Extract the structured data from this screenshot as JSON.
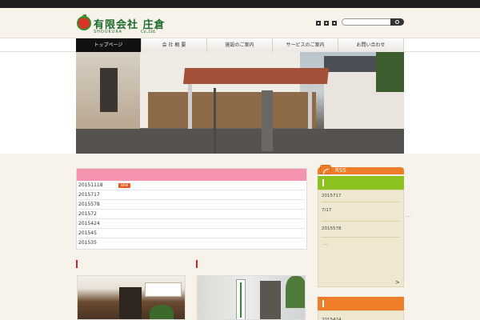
{
  "header": {
    "logo_title": "有限会社 庄倉",
    "logo_sub": "SHOUKURA",
    "logo_co": "Co.,Ltd.",
    "social_icons": [
      "twitter-icon",
      "facebook-icon",
      "rss-small-icon"
    ],
    "search_placeholder": ""
  },
  "nav": {
    "items": [
      {
        "label": "トップページ",
        "active": true
      },
      {
        "label": "会 社 概 要"
      },
      {
        "label": "施設のご案内"
      },
      {
        "label": "サービスのご案内"
      },
      {
        "label": "お問い合わせ"
      }
    ]
  },
  "news": {
    "items": [
      {
        "date": "20151118",
        "badge": "NEW"
      },
      {
        "date": "2015717"
      },
      {
        "date": "2015578"
      },
      {
        "date": "201572"
      },
      {
        "date": "2015424"
      },
      {
        "date": "201545"
      },
      {
        "date": "201535"
      }
    ]
  },
  "sidebar": {
    "rss_label": "RSS",
    "panel1": {
      "rows": [
        "2015717",
        "7/17",
        "2015578"
      ],
      "ellipsis": "…",
      "more": ">"
    },
    "panel2": {
      "rows": [
        "2015424"
      ]
    }
  },
  "colors": {
    "news_header": "#f594ae",
    "green": "#8cc31f",
    "orange": "#f07d2a",
    "nav_active": "#111111"
  }
}
